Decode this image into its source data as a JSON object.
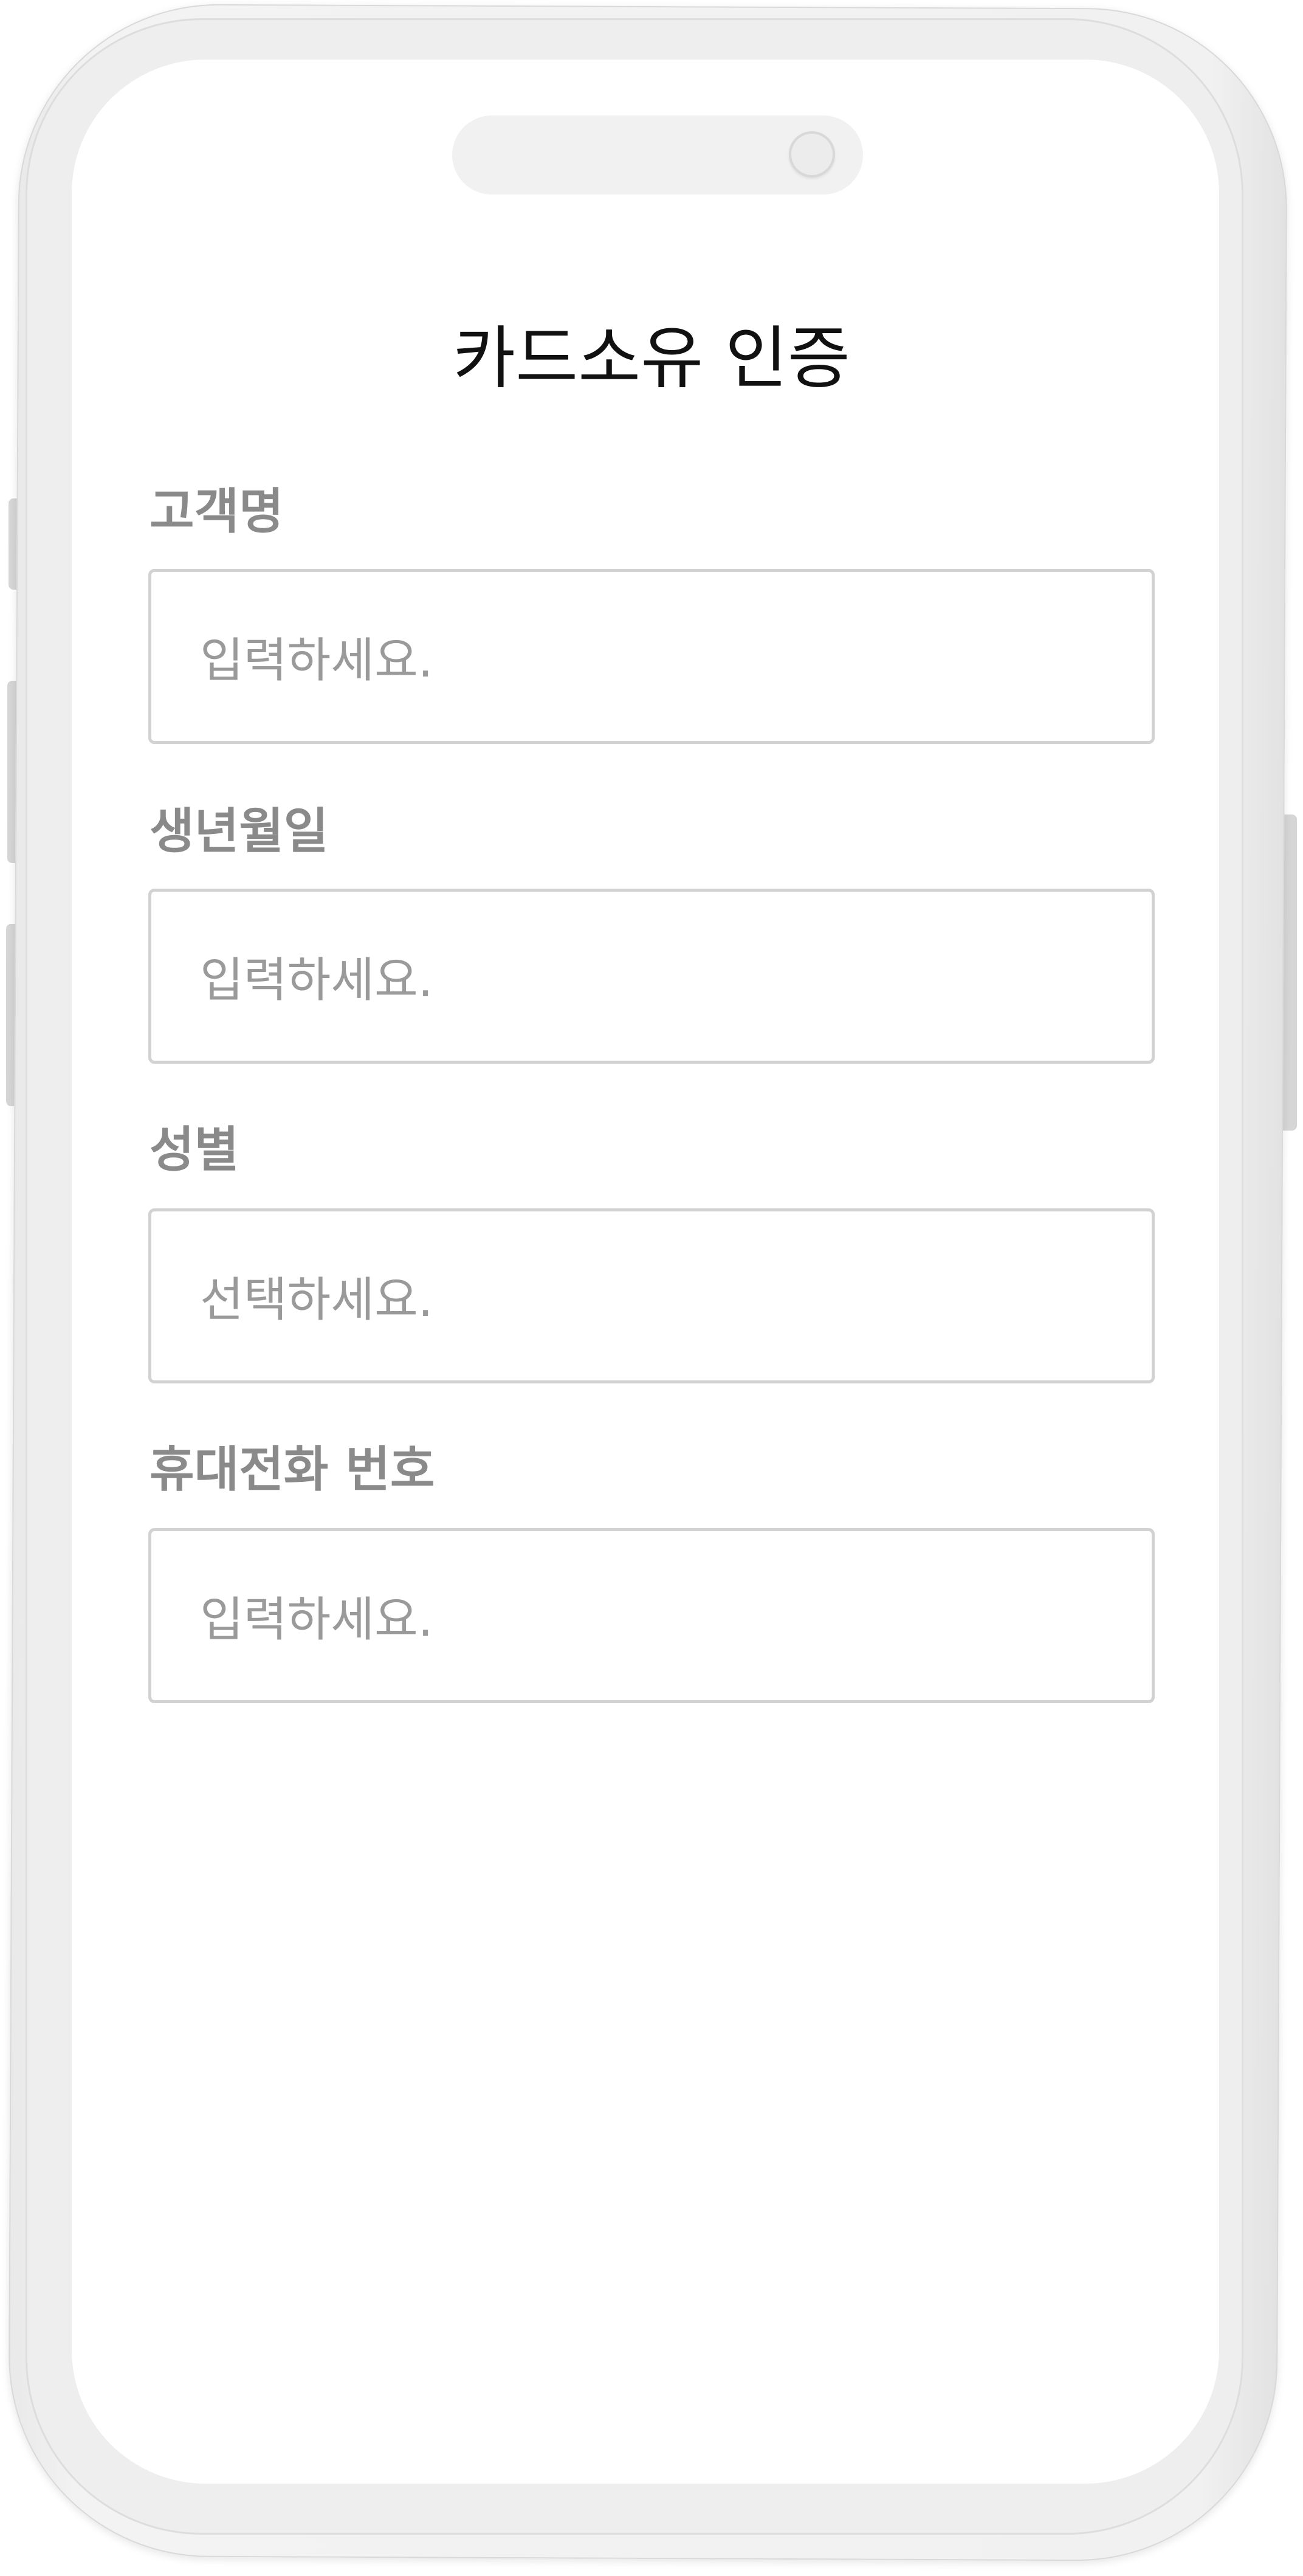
{
  "header": {
    "title": "카드소유 인증"
  },
  "form": {
    "fields": [
      {
        "label": "고객명",
        "placeholder": "입력하세요.",
        "type": "text"
      },
      {
        "label": "생년월일",
        "placeholder": "입력하세요.",
        "type": "text"
      },
      {
        "label": "성별",
        "placeholder": "선택하세요.",
        "type": "select"
      },
      {
        "label": "휴대전화 번호",
        "placeholder": "입력하세요.",
        "type": "text"
      }
    ]
  },
  "colors": {
    "label": "#8a8a8a",
    "placeholder": "#9a9a9a",
    "border": "#d2d2d2",
    "title": "#111111"
  }
}
